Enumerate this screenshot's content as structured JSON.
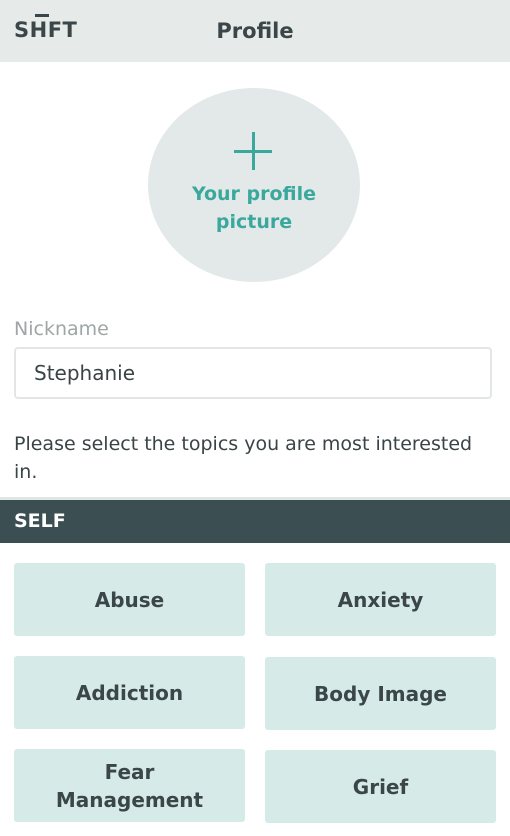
{
  "header": {
    "logo": "SHFT",
    "title": "Profile"
  },
  "avatar": {
    "label": "Your profile\npicture"
  },
  "nickname": {
    "label": "Nickname",
    "value": "Stephanie"
  },
  "prompt": "Please select the topics you are most interested in.",
  "section": {
    "title": "SELF",
    "topics": [
      "Abuse",
      "Anxiety",
      "Addiction",
      "Body Image",
      "Fear\nManagement",
      "Grief"
    ]
  },
  "colors": {
    "accent": "#3aa89c",
    "tile_bg": "#d6eae8",
    "section_bg": "#3b4e51",
    "topbar_bg": "#e6ebea"
  }
}
